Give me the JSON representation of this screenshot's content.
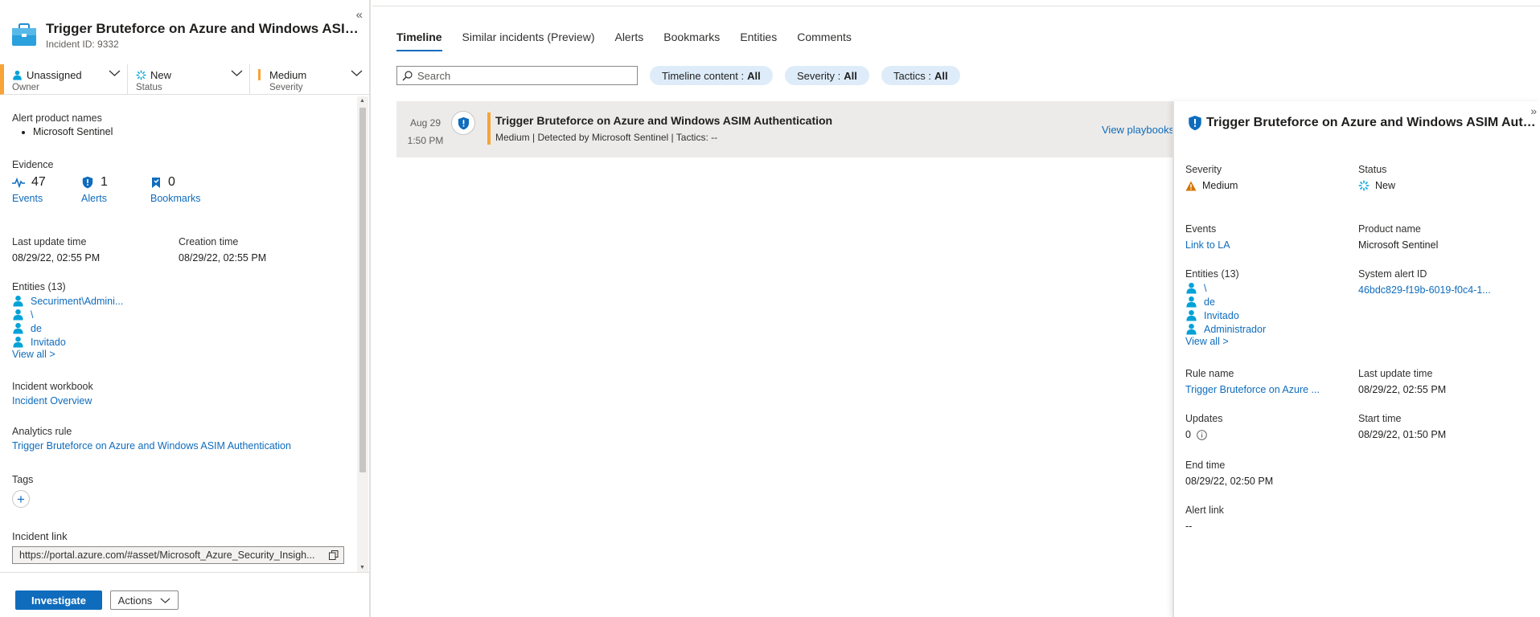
{
  "incident": {
    "title": "Trigger Bruteforce on Azure and Windows ASIM Authentication",
    "id_label": "Incident ID: 9332"
  },
  "status_bar": {
    "owner": {
      "value": "Unassigned",
      "label": "Owner"
    },
    "status": {
      "value": "New",
      "label": "Status"
    },
    "severity": {
      "value": "Medium",
      "label": "Severity"
    }
  },
  "left": {
    "alert_products_label": "Alert product names",
    "alert_products": [
      "Microsoft Sentinel"
    ],
    "evidence_label": "Evidence",
    "evidence": {
      "events": {
        "count": "47",
        "label": "Events"
      },
      "alerts": {
        "count": "1",
        "label": "Alerts"
      },
      "bookmarks": {
        "count": "0",
        "label": "Bookmarks"
      }
    },
    "last_update_label": "Last update time",
    "last_update_value": "08/29/22, 02:55 PM",
    "creation_label": "Creation time",
    "creation_value": "08/29/22, 02:55 PM",
    "entities_label": "Entities (13)",
    "entities": [
      "Securiment\\Admini...",
      "\\",
      "de",
      "Invitado"
    ],
    "view_all": "View all >",
    "workbook_label": "Incident workbook",
    "workbook_link": "Incident Overview",
    "analytics_label": "Analytics rule",
    "analytics_link": "Trigger Bruteforce on Azure and Windows ASIM Authentication",
    "tags_label": "Tags",
    "incident_link_label": "Incident link",
    "incident_link_value": "https://portal.azure.com/#asset/Microsoft_Azure_Security_Insigh..."
  },
  "footer": {
    "investigate": "Investigate",
    "actions": "Actions"
  },
  "tabs": [
    "Timeline",
    "Similar incidents (Preview)",
    "Alerts",
    "Bookmarks",
    "Entities",
    "Comments"
  ],
  "search": {
    "placeholder": "Search"
  },
  "filters": [
    {
      "label": "Timeline content :",
      "value": "All"
    },
    {
      "label": "Severity :",
      "value": "All"
    },
    {
      "label": "Tactics :",
      "value": "All"
    }
  ],
  "timeline_item": {
    "date": "Aug 29",
    "time": "1:50 PM",
    "title": "Trigger Bruteforce on Azure and Windows ASIM Authentication",
    "subtitle": "Medium | Detected by Microsoft Sentinel | Tactics: --",
    "action": "View playbooks"
  },
  "details": {
    "title": "Trigger Bruteforce on Azure and Windows ASIM Authentication",
    "severity_label": "Severity",
    "severity_value": "Medium",
    "status_label": "Status",
    "status_value": "New",
    "events_label": "Events",
    "events_link": "Link to LA",
    "product_label": "Product name",
    "product_value": "Microsoft Sentinel",
    "entities_label": "Entities (13)",
    "entities": [
      "\\",
      "de",
      "Invitado",
      "Administrador"
    ],
    "view_all": "View all >",
    "system_alert_label": "System alert ID",
    "system_alert_value": "46bdc829-f19b-6019-f0c4-1...",
    "rule_label": "Rule name",
    "rule_value": "Trigger Bruteforce on Azure ...",
    "last_update_label": "Last update time",
    "last_update_value": "08/29/22, 02:55 PM",
    "updates_label": "Updates",
    "updates_value": "0",
    "start_label": "Start time",
    "start_value": "08/29/22, 01:50 PM",
    "end_label": "End time",
    "end_value": "08/29/22, 02:50 PM",
    "alert_link_label": "Alert link",
    "alert_link_value": "--"
  },
  "colors": {
    "accent": "#0f6cbd",
    "severity_medium": "#f7a337",
    "warning_icon": "#d47500",
    "entity_icon": "#00a2d8"
  }
}
